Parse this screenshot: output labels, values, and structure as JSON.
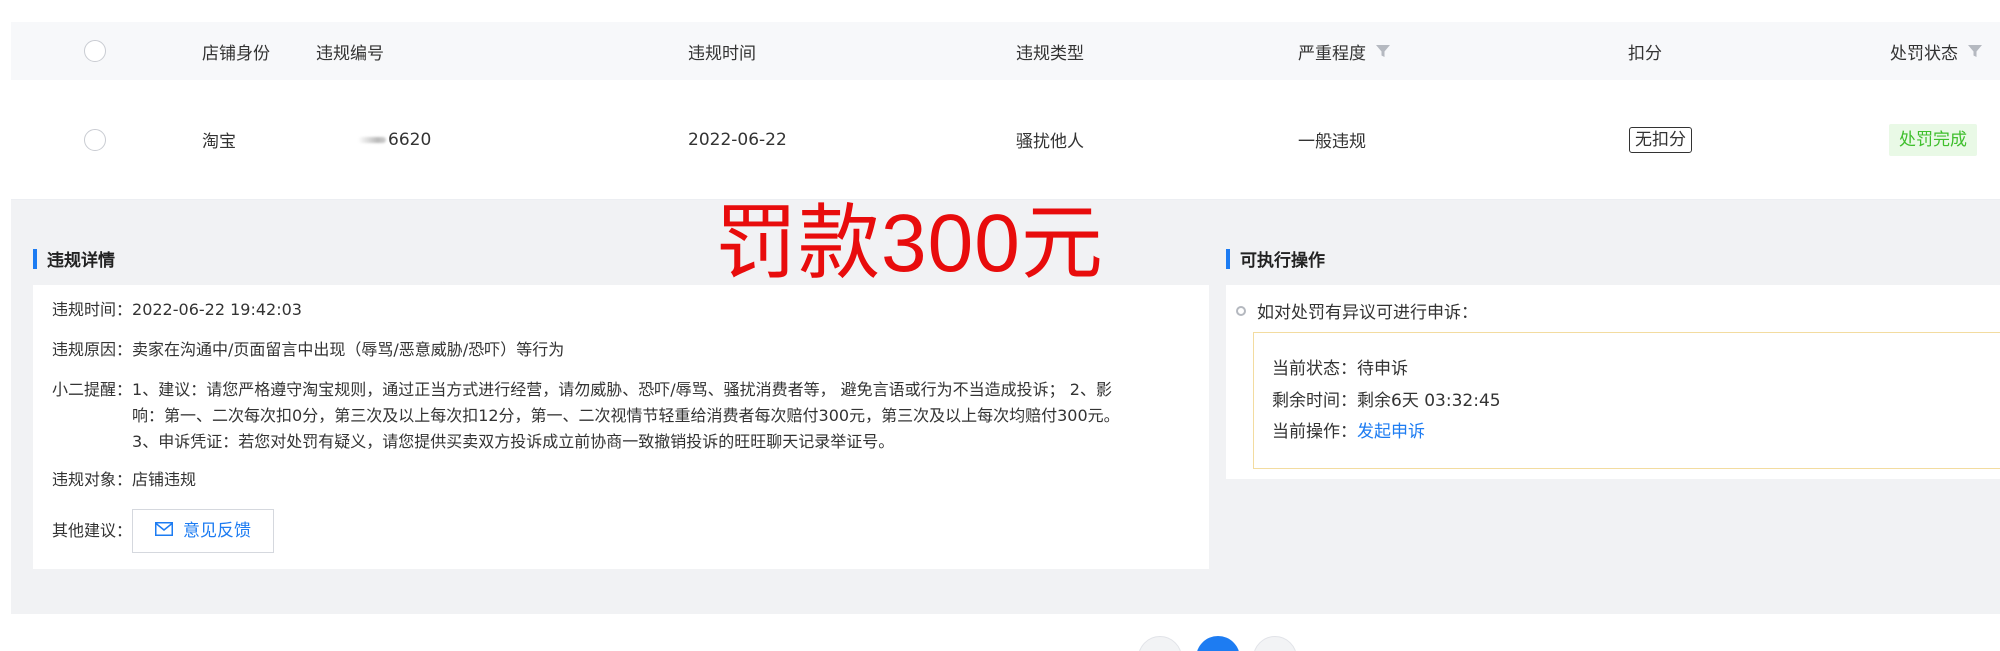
{
  "table": {
    "headers": {
      "shop_identity": "店铺身份",
      "violation_id": "违规编号",
      "violation_time": "违规时间",
      "violation_type": "违规类型",
      "severity": "严重程度",
      "deduction": "扣分",
      "penalty_status": "处罚状态"
    },
    "row": {
      "shop_identity": "淘宝",
      "violation_id_suffix": "6620",
      "violation_time": "2022-06-22",
      "violation_type": "骚扰他人",
      "severity": "一般违规",
      "deduction": "无扣分",
      "penalty_status": "处罚完成"
    }
  },
  "detail": {
    "title": "违规详情",
    "time_label": "违规时间：",
    "time_value": "2022-06-22 19:42:03",
    "reason_label": "违规原因：",
    "reason_value": "卖家在沟通中/页面留言中出现（辱骂/恶意威胁/恐吓）等行为",
    "reminder_label": "小二提醒：",
    "reminder_line1": "1、建议：请您严格遵守淘宝规则，通过正当方式进行经营，请勿威胁、恐吓/辱骂、骚扰消费者等， 避免言语或行为不当造成投诉； 2、影",
    "reminder_line2": "响：第一、二次每次扣0分，第三次及以上每次扣12分，第一、二次视情节轻重给消费者每次赔付300元，第三次及以上每次均赔付300元。",
    "reminder_line3": "3、申诉凭证：若您对处罚有疑义，请您提供买卖双方投诉成立前协商一致撤销投诉的旺旺聊天记录举证号。",
    "object_label": "违规对象：",
    "object_value": "店铺违规",
    "suggestion_label": "其他建议：",
    "feedback_button": "意见反馈"
  },
  "operations": {
    "title": "可执行操作",
    "hint": "如对处罚有异议可进行申诉：",
    "status_label": "当前状态：",
    "status_value": "待申诉",
    "remaining_label": "剩余时间：",
    "remaining_value": "剩余6天 03:32:45",
    "action_label": "当前操作：",
    "action_link": "发起申诉"
  },
  "overlay": {
    "text": "罚款300元",
    "color": "#e80c0c"
  },
  "colors": {
    "accent": "#1d7cf2",
    "success_text": "#3fbf2d",
    "success_bg": "#e9f9e6"
  },
  "icons": {
    "filter": "filter-funnel-icon",
    "mail": "mail-icon",
    "bullet": "hollow-circle-icon"
  }
}
